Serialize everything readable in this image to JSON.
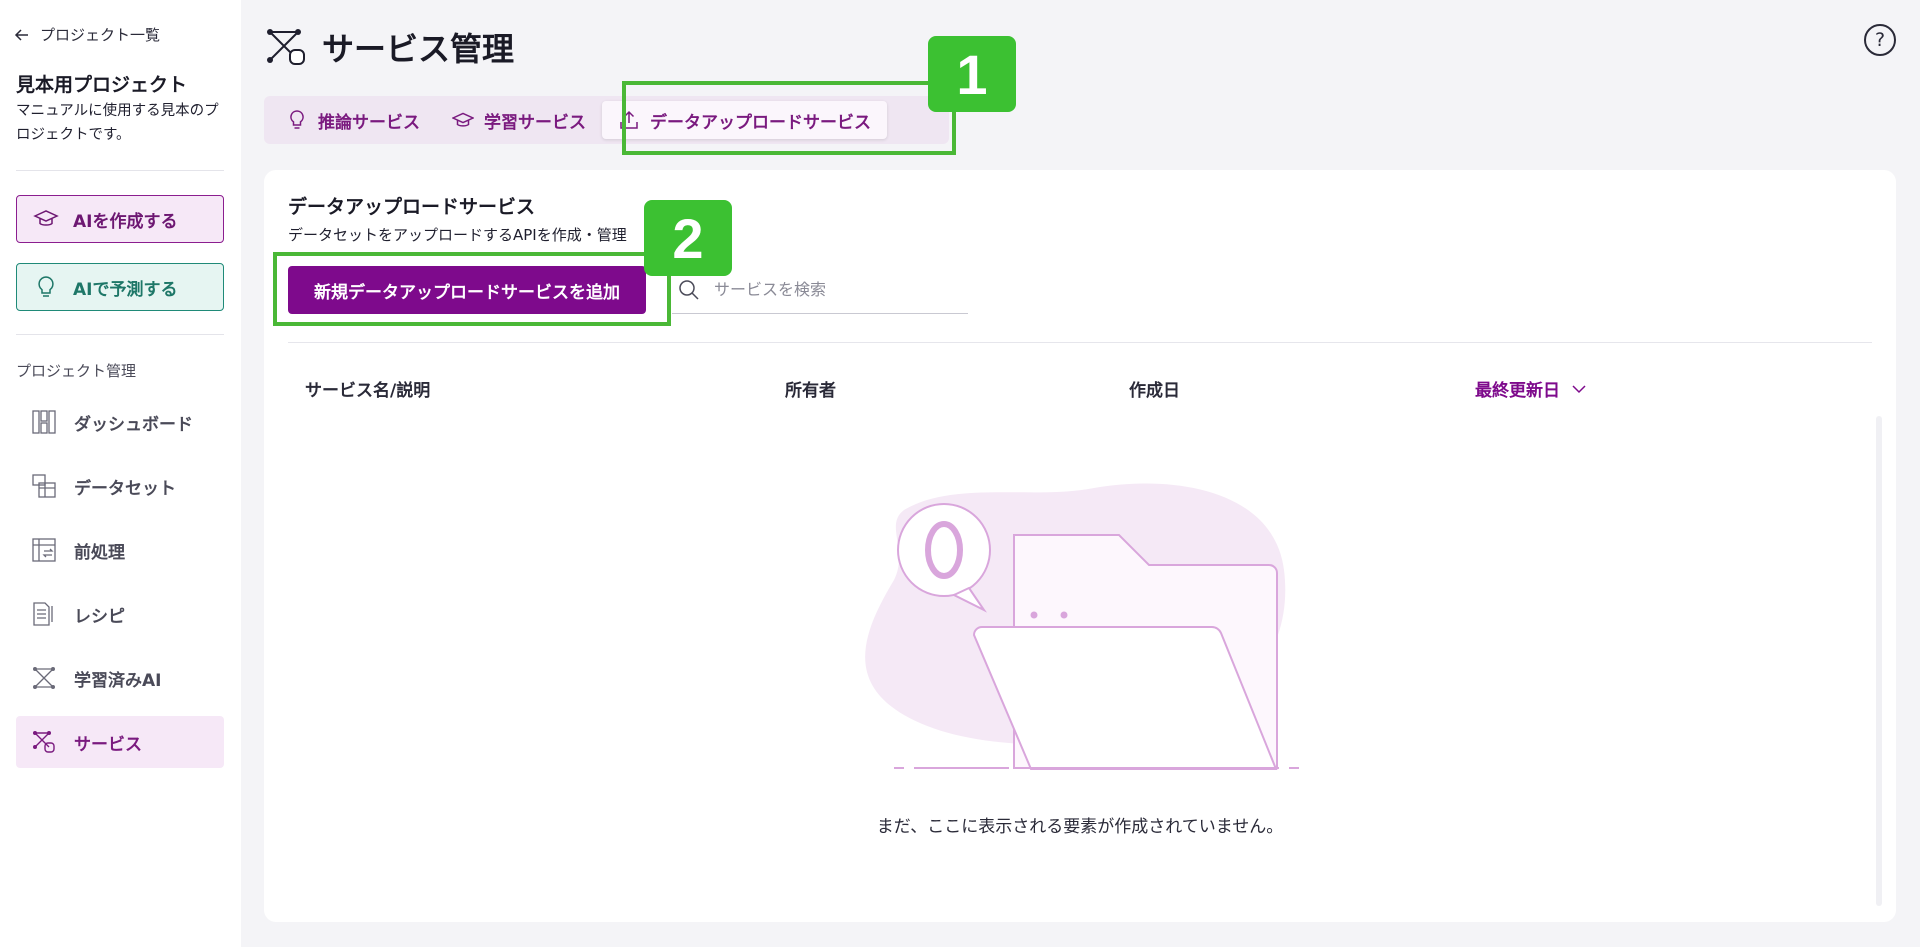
{
  "sidebar": {
    "back_label": "プロジェクト一覧",
    "project_title": "見本用プロジェクト",
    "project_desc": "マニュアルに使用する見本のプロジェクトです。",
    "create_ai_label": "AIを作成する",
    "predict_ai_label": "AIで予測する",
    "section_label": "プロジェクト管理",
    "nav": [
      {
        "label": "ダッシュボード",
        "icon": "dashboard-icon"
      },
      {
        "label": "データセット",
        "icon": "dataset-icon"
      },
      {
        "label": "前処理",
        "icon": "preprocess-icon"
      },
      {
        "label": "レシピ",
        "icon": "recipe-icon"
      },
      {
        "label": "学習済みAI",
        "icon": "trained-ai-icon"
      },
      {
        "label": "サービス",
        "icon": "service-icon",
        "active": true
      }
    ]
  },
  "header": {
    "title": "サービス管理",
    "help_symbol": "?"
  },
  "tabs": [
    {
      "label": "推論サービス",
      "icon": "lightbulb-icon"
    },
    {
      "label": "学習サービス",
      "icon": "graduation-cap-icon"
    },
    {
      "label": "データアップロードサービス",
      "icon": "upload-icon",
      "active": true
    }
  ],
  "card": {
    "title": "データアップロードサービス",
    "subtitle": "データセットをアップロードするAPIを作成・管理",
    "add_button": "新規データアップロードサービスを追加",
    "search_placeholder": "サービスを検索",
    "columns": [
      "サービス名/説明",
      "所有者",
      "作成日",
      "最終更新日"
    ],
    "empty_message": "まだ、ここに表示される要素が作成されていません。",
    "empty_badge": "0"
  },
  "annotations": [
    "1",
    "2"
  ],
  "colors": {
    "accent": "#7e0a8c",
    "teal": "#1f8a78",
    "annotation": "#3cc132"
  }
}
